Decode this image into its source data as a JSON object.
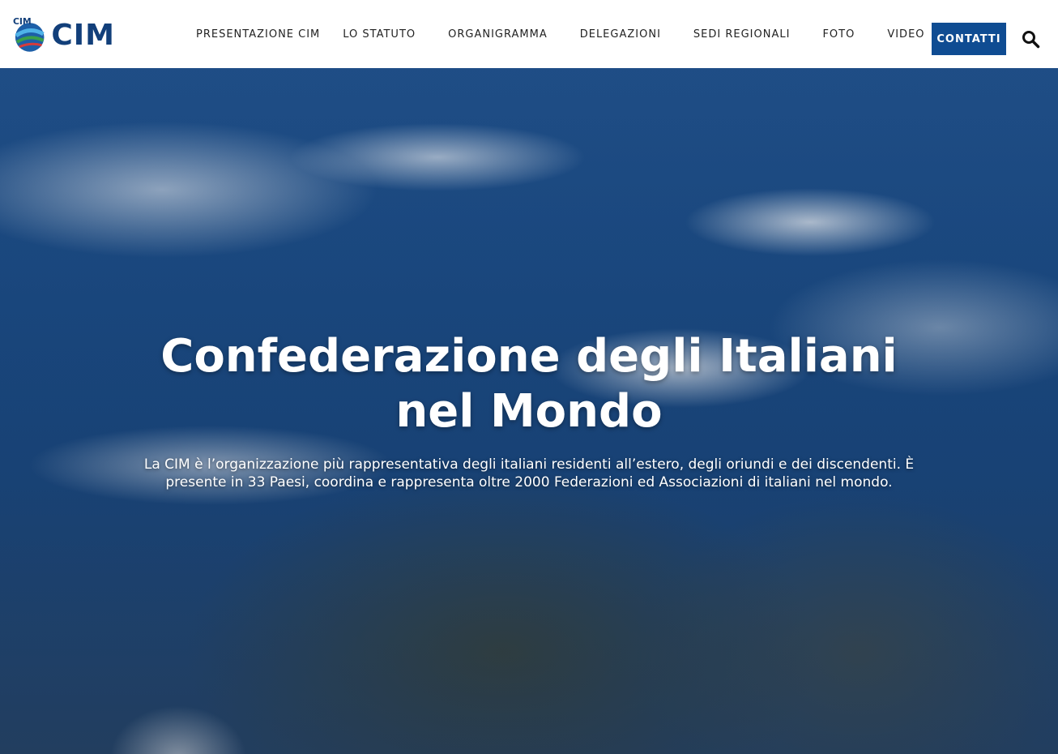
{
  "header": {
    "logo_text": "CIM",
    "logo_badge": "CIM",
    "nav": [
      {
        "label": "PRESENTAZIONE CIM"
      },
      {
        "label": "LO STATUTO"
      },
      {
        "label": "ORGANIGRAMMA"
      },
      {
        "label": "DELEGAZIONI"
      },
      {
        "label": "SEDI REGIONALI"
      },
      {
        "label": "FOTO"
      },
      {
        "label": "VIDEO"
      }
    ],
    "cta_label": "CONTATTI",
    "search_icon": "search-icon"
  },
  "hero": {
    "title_line1": "Confederazione degli Italiani",
    "title_line2": "nel Mondo",
    "subtitle": "La CIM è l’organizzazione più rappresentativa degli italiani residenti all’estero, degli oriundi e dei discendenti. È presente in 33 Paesi, coordina e rappresenta oltre 2000 Federazioni ed Associazioni di italiani nel mondo."
  },
  "colors": {
    "brand_blue": "#0f4c92",
    "logo_text": "#123f7a",
    "nav_text": "#222222"
  }
}
